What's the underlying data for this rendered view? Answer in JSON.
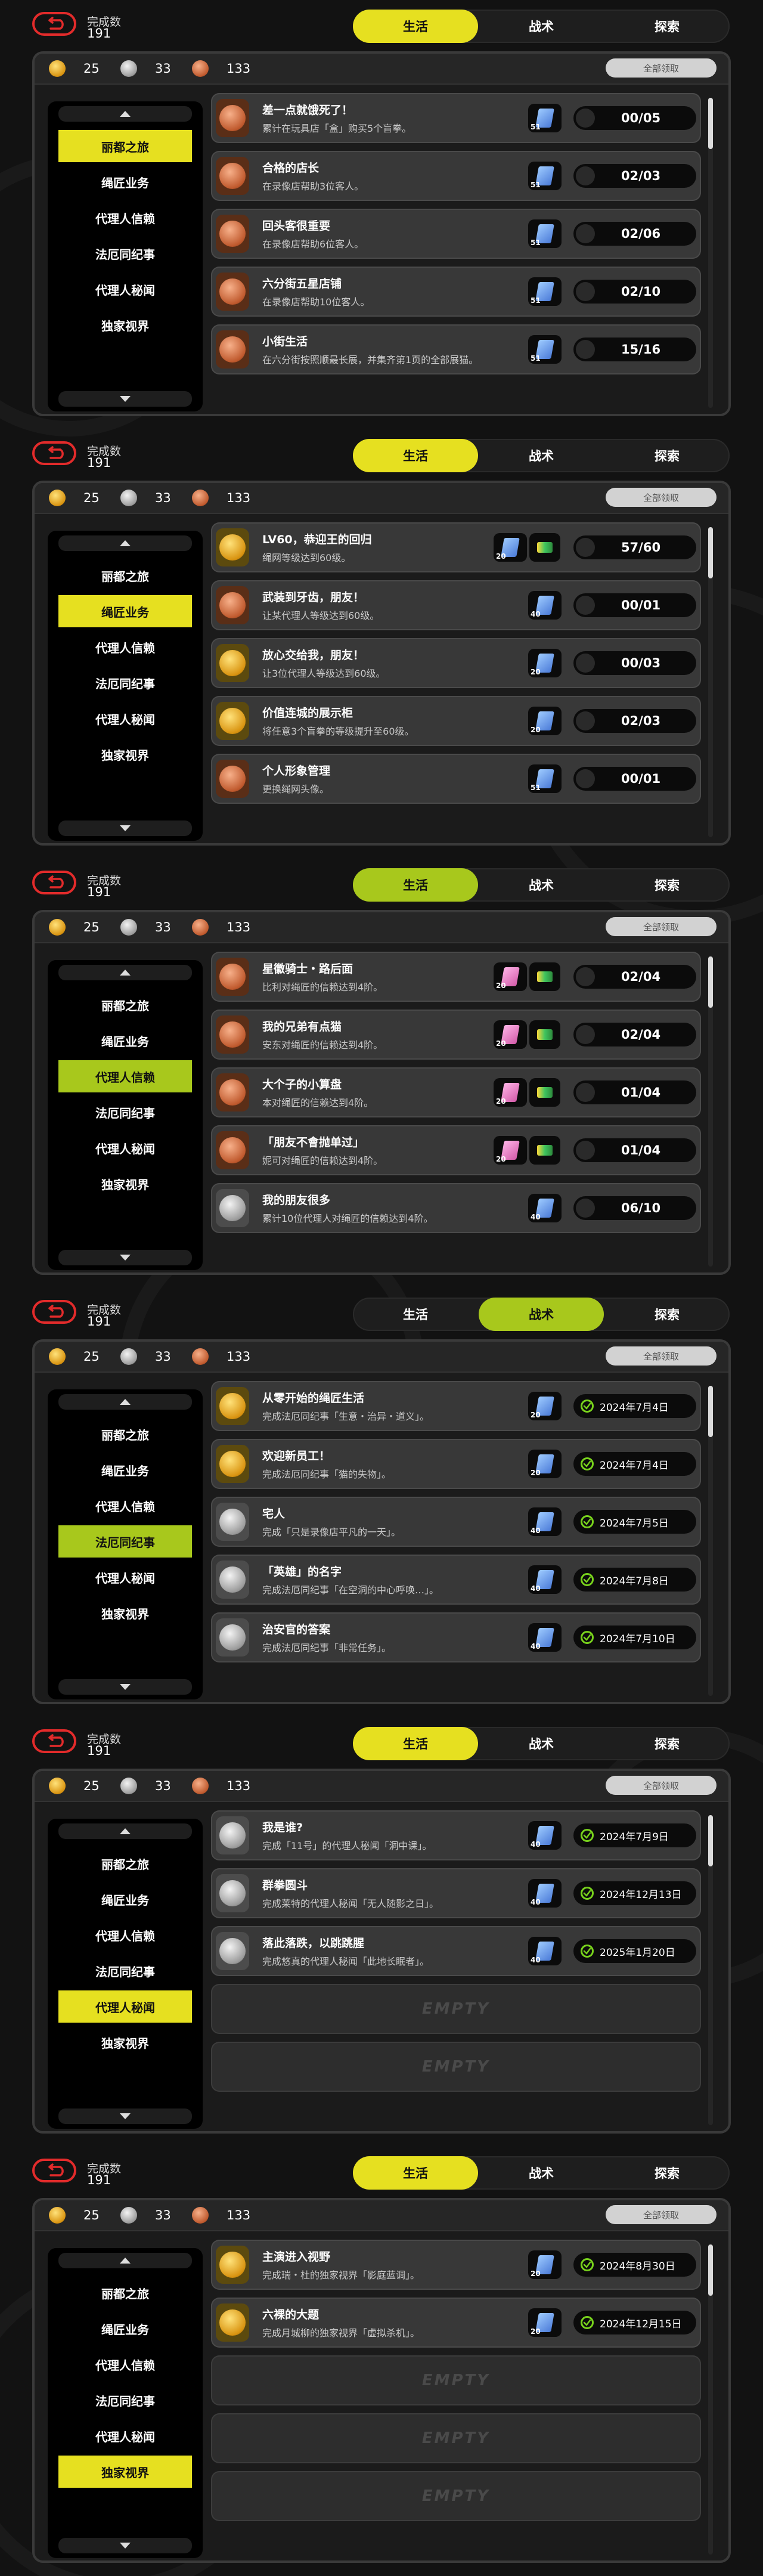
{
  "header": {
    "completion_label": "完成数",
    "completion_value": "191"
  },
  "tabs": [
    "生活",
    "战术",
    "探索"
  ],
  "currency": {
    "gold": "25",
    "silver": "33",
    "bronze": "133"
  },
  "claim_all_label": "全部领取",
  "sidebar": [
    "丽都之旅",
    "绳匠业务",
    "代理人信赖",
    "法厄同纪事",
    "代理人秘闻",
    "独家视界"
  ],
  "empty_label": "EMPTY",
  "colors": {
    "active_yellow": "#e6e020",
    "active_green": "#a8c81c",
    "back_red": "#e32b2b"
  },
  "panels": [
    {
      "active_tab": 0,
      "active_side": 0,
      "rows": [
        {
          "medal": "bronze",
          "title": "差一点就饿死了！",
          "desc": "累计在玩具店「盒」购买5个盲拳。",
          "rewards": [
            {
              "icon": "ticket-blue",
              "num": "51"
            }
          ],
          "progress": "00/05"
        },
        {
          "medal": "bronze",
          "title": "合格的店长",
          "desc": "在录像店帮助3位客人。",
          "rewards": [
            {
              "icon": "ticket-blue",
              "num": "51"
            }
          ],
          "progress": "02/03"
        },
        {
          "medal": "bronze",
          "title": "回头客很重要",
          "desc": "在录像店帮助6位客人。",
          "rewards": [
            {
              "icon": "ticket-blue",
              "num": "51"
            }
          ],
          "progress": "02/06"
        },
        {
          "medal": "bronze",
          "title": "六分街五星店铺",
          "desc": "在录像店帮助10位客人。",
          "rewards": [
            {
              "icon": "ticket-blue",
              "num": "51"
            }
          ],
          "progress": "02/10"
        },
        {
          "medal": "bronze",
          "title": "小街生活",
          "desc": "在六分街按照顺最长展，并集齐第1页的全部展猫。",
          "rewards": [
            {
              "icon": "ticket-blue",
              "num": "51"
            }
          ],
          "progress": "15/16"
        }
      ]
    },
    {
      "active_tab": 0,
      "active_side": 1,
      "rows": [
        {
          "medal": "gold",
          "title": "LV60，恭迎王的回归",
          "desc": "绳网等级达到60级。",
          "rewards": [
            {
              "icon": "ticket-blue",
              "num": "20"
            },
            {
              "icon": "chip",
              "num": ""
            }
          ],
          "progress": "57/60"
        },
        {
          "medal": "bronze",
          "title": "武装到牙齿，朋友！",
          "desc": "让某代理人等级达到60级。",
          "rewards": [
            {
              "icon": "ticket-blue",
              "num": "40"
            }
          ],
          "progress": "00/01"
        },
        {
          "medal": "gold",
          "title": "放心交给我，朋友！",
          "desc": "让3位代理人等级达到60级。",
          "rewards": [
            {
              "icon": "ticket-blue",
              "num": "20"
            }
          ],
          "progress": "00/03"
        },
        {
          "medal": "gold",
          "title": "价值连城的展示柜",
          "desc": "将任意3个盲拳的等级提升至60级。",
          "rewards": [
            {
              "icon": "ticket-blue",
              "num": "20"
            }
          ],
          "progress": "02/03"
        },
        {
          "medal": "bronze",
          "title": "个人形象管理",
          "desc": "更换绳网头像。",
          "rewards": [
            {
              "icon": "ticket-blue",
              "num": "51"
            }
          ],
          "progress": "00/01"
        }
      ]
    },
    {
      "active_tab": 0,
      "active_side": 2,
      "rows": [
        {
          "medal": "bronze",
          "title": "星徽骑士・路后面",
          "desc": "比利对绳匠的信赖达到4阶。",
          "rewards": [
            {
              "icon": "ticket-pink",
              "num": "20"
            },
            {
              "icon": "chip",
              "num": ""
            }
          ],
          "progress": "02/04"
        },
        {
          "medal": "bronze",
          "title": "我的兄弟有点猫",
          "desc": "安东对绳匠的信赖达到4阶。",
          "rewards": [
            {
              "icon": "ticket-pink",
              "num": "20"
            },
            {
              "icon": "chip",
              "num": ""
            }
          ],
          "progress": "02/04"
        },
        {
          "medal": "bronze",
          "title": "大个子的小算盘",
          "desc": "本对绳匠的信赖达到4阶。",
          "rewards": [
            {
              "icon": "ticket-pink",
              "num": "20"
            },
            {
              "icon": "chip",
              "num": ""
            }
          ],
          "progress": "01/04"
        },
        {
          "medal": "bronze",
          "title": "「朋友不會抛单过」",
          "desc": "妮可对绳匠的信赖达到4阶。",
          "rewards": [
            {
              "icon": "ticket-pink",
              "num": "20"
            },
            {
              "icon": "chip",
              "num": ""
            }
          ],
          "progress": "01/04"
        },
        {
          "medal": "silver",
          "title": "我的朋友很多",
          "desc": "累计10位代理人对绳匠的信赖达到4阶。",
          "rewards": [
            {
              "icon": "ticket-blue",
              "num": "40"
            }
          ],
          "progress": "06/10"
        }
      ]
    },
    {
      "active_tab": 1,
      "active_side": 3,
      "rows": [
        {
          "medal": "gold",
          "title": "从零开始的绳匠生活",
          "desc": "完成法厄同纪事「生意・治异・道义」。",
          "rewards": [
            {
              "icon": "ticket-blue",
              "num": "20"
            }
          ],
          "date": "2024年7月4日"
        },
        {
          "medal": "gold",
          "title": "欢迎新员工！",
          "desc": "完成法厄同纪事「猫的失物」。",
          "rewards": [
            {
              "icon": "ticket-blue",
              "num": "20"
            }
          ],
          "date": "2024年7月4日"
        },
        {
          "medal": "silver",
          "title": "宅人",
          "desc": "完成「只是录像店平凡的一天」。",
          "rewards": [
            {
              "icon": "ticket-blue",
              "num": "40"
            }
          ],
          "date": "2024年7月5日"
        },
        {
          "medal": "silver",
          "title": "「英雄」的名字",
          "desc": "完成法厄同纪事「在空洞的中心呼唤…」。",
          "rewards": [
            {
              "icon": "ticket-blue",
              "num": "40"
            }
          ],
          "date": "2024年7月8日"
        },
        {
          "medal": "silver",
          "title": "治安官的答案",
          "desc": "完成法厄同纪事「非常任务」。",
          "rewards": [
            {
              "icon": "ticket-blue",
              "num": "40"
            }
          ],
          "date": "2024年7月10日"
        }
      ]
    },
    {
      "active_tab": 0,
      "active_side": 4,
      "rows": [
        {
          "medal": "silver",
          "title": "我是谁?",
          "desc": "完成「11号」的代理人秘闻「洞中课」。",
          "rewards": [
            {
              "icon": "ticket-blue",
              "num": "40"
            }
          ],
          "date": "2024年7月9日"
        },
        {
          "medal": "silver",
          "title": "群拳圆斗",
          "desc": "完成莱特的代理人秘闻「无人随影之日」。",
          "rewards": [
            {
              "icon": "ticket-blue",
              "num": "40"
            }
          ],
          "date": "2024年12月13日"
        },
        {
          "medal": "silver",
          "title": "落此落跌，以跳跳腥",
          "desc": "完成悠真的代理人秘闻「此地长眠者」。",
          "rewards": [
            {
              "icon": "ticket-blue",
              "num": "40"
            }
          ],
          "date": "2025年1月20日"
        }
      ]
    },
    {
      "active_tab": 0,
      "active_side": 5,
      "rows": [
        {
          "medal": "gold",
          "title": "主演进入视野",
          "desc": "完成瑞・杜的独家视界「影庭蓝调」。",
          "rewards": [
            {
              "icon": "ticket-blue",
              "num": "20"
            }
          ],
          "date": "2024年8月30日"
        },
        {
          "medal": "gold",
          "title": "六裸的大题",
          "desc": "完成月城柳的独家视界「虚拟杀机」。",
          "rewards": [
            {
              "icon": "ticket-blue",
              "num": "20"
            }
          ],
          "date": "2024年12月15日"
        }
      ]
    }
  ]
}
